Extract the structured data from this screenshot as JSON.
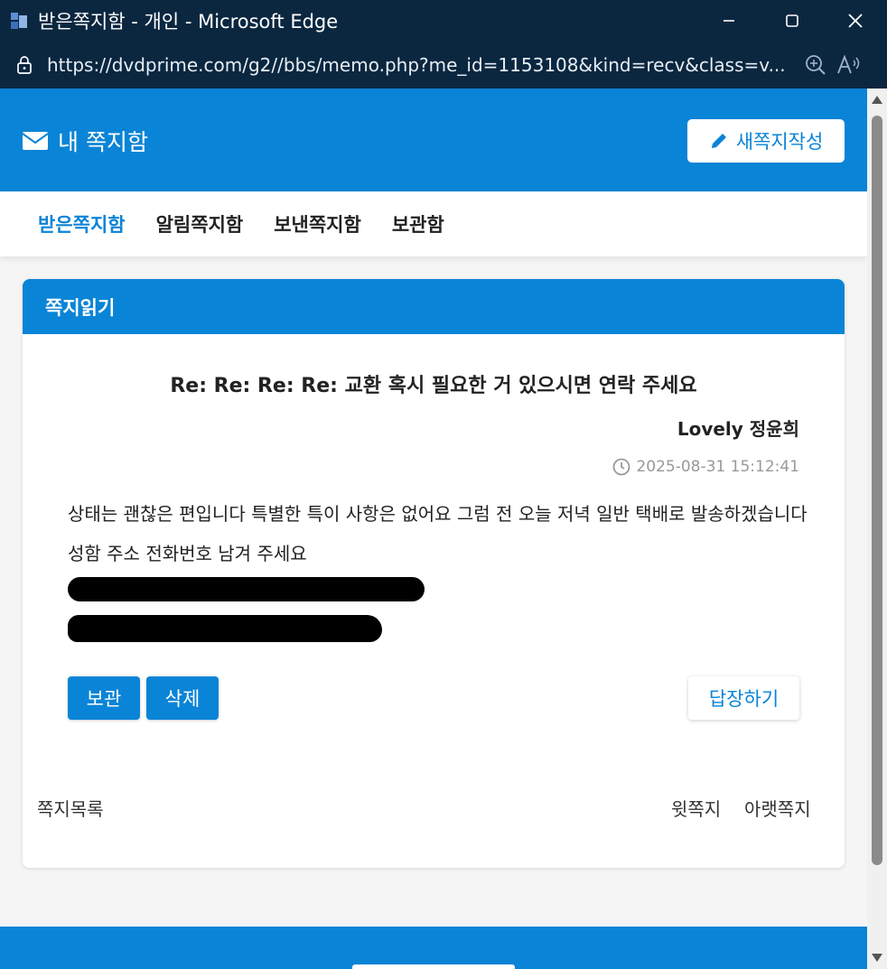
{
  "window": {
    "title": "받은쪽지함 - 개인 - Microsoft Edge",
    "url": "https://dvdprime.com/g2//bbs/memo.php?me_id=1153108&kind=recv&class=v..."
  },
  "header": {
    "title": "내 쪽지함",
    "compose_label": "새쪽지작성"
  },
  "tabs": [
    {
      "label": "받은쪽지함",
      "active": true
    },
    {
      "label": "알림쪽지함",
      "active": false
    },
    {
      "label": "보낸쪽지함",
      "active": false
    },
    {
      "label": "보관함",
      "active": false
    }
  ],
  "memo": {
    "panel_title": "쪽지읽기",
    "subject": "Re: Re: Re: Re: 교환 혹시 필요한 거 있으시면 연락 주세요",
    "sender": "Lovely 정윤희",
    "datetime": "2025-08-31 15:12:41",
    "body": "상태는 괜찮은 편입니다 특별한 특이 사항은 없어요 그럼 전 오늘 저녁 일반 택배로 발송하겠습니다 성함 주소 전화번호 남겨 주세요"
  },
  "actions": {
    "archive_label": "보관",
    "delete_label": "삭제",
    "reply_label": "답장하기"
  },
  "nav": {
    "list_label": "쪽지목록",
    "prev_label": "윗쪽지",
    "next_label": "아랫쪽지"
  },
  "colors": {
    "accent": "#0a84d6",
    "titlebar": "#0b2740"
  }
}
